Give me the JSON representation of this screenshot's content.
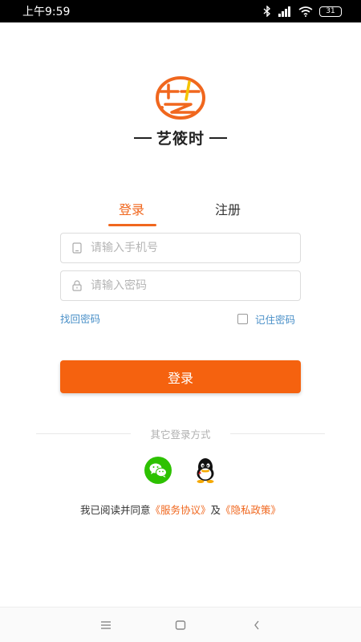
{
  "status_bar": {
    "time": "上午9:59",
    "battery": "31"
  },
  "logo": {
    "text": "艺筱时"
  },
  "tabs": [
    {
      "label": "登录",
      "active": true
    },
    {
      "label": "注册",
      "active": false
    }
  ],
  "form": {
    "phone_placeholder": "请输入手机号",
    "password_placeholder": "请输入密码",
    "forgot_label": "找回密码",
    "remember_label": "记住密码",
    "remember_checked": false,
    "login_label": "登录"
  },
  "other_login": {
    "label": "其它登录方式",
    "options": [
      {
        "icon": "wechat-icon"
      },
      {
        "icon": "qq-icon"
      }
    ]
  },
  "agreement": {
    "prefix": "我已阅读并同意",
    "service_link": "《服务协议》",
    "conjunction": "及",
    "privacy_link": "《隐私政策》"
  },
  "colors": {
    "accent": "#f0671e",
    "button": "#f5620f",
    "link_blue": "#4a90c8",
    "wechat_green": "#2dc100"
  }
}
